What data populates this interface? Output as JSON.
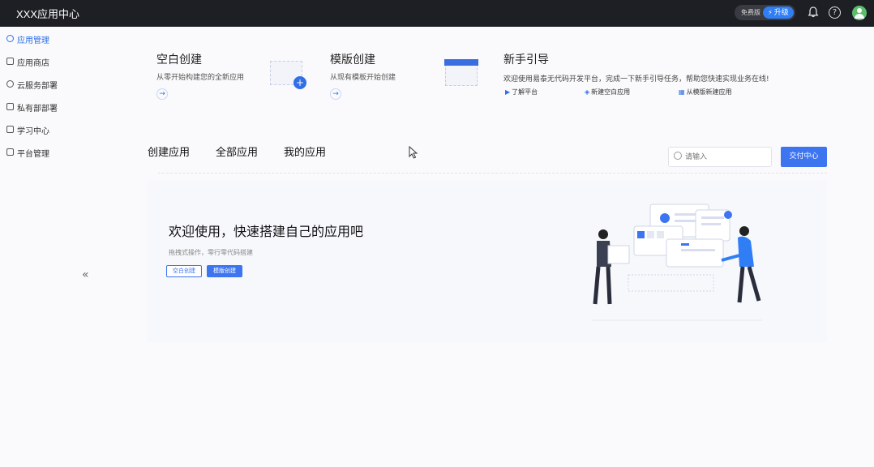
{
  "header": {
    "title": "XXX应用中心",
    "version": "免费版",
    "upgrade": "升级",
    "help": "?"
  },
  "sidebar": {
    "items": [
      {
        "label": "应用管理",
        "active": true
      },
      {
        "label": "应用商店"
      },
      {
        "label": "云服务部署"
      },
      {
        "label": "私有部部署"
      },
      {
        "label": "学习中心"
      },
      {
        "label": "平台管理"
      }
    ],
    "collapse": "«"
  },
  "cards": {
    "blank": {
      "title": "空白创建",
      "desc": "从零开始构建您的全新应用",
      "arrow": "→"
    },
    "template": {
      "title": "模版创建",
      "desc": "从现有模板开始创建",
      "arrow": "→"
    },
    "guide": {
      "title": "新手引导",
      "desc": "欢迎使用易泰无代码开发平台，完成一下新手引导任务，帮助您快速实现业务在线!",
      "links": [
        "了解平台",
        "新建空白应用",
        "从模版新建应用"
      ]
    }
  },
  "tabs": [
    "创建应用",
    "全部应用",
    "我的应用"
  ],
  "search": {
    "placeholder": "请输入"
  },
  "deliver_button": "交付中心",
  "welcome": {
    "title": "欢迎使用，快速搭建自己的应用吧",
    "subtitle": "拖拽式操作，零行零代码搭建",
    "btn_blank": "空白创建",
    "btn_template": "模版创建"
  },
  "colors": {
    "accent": "#3d74f0",
    "topbar": "#1e1f24"
  }
}
